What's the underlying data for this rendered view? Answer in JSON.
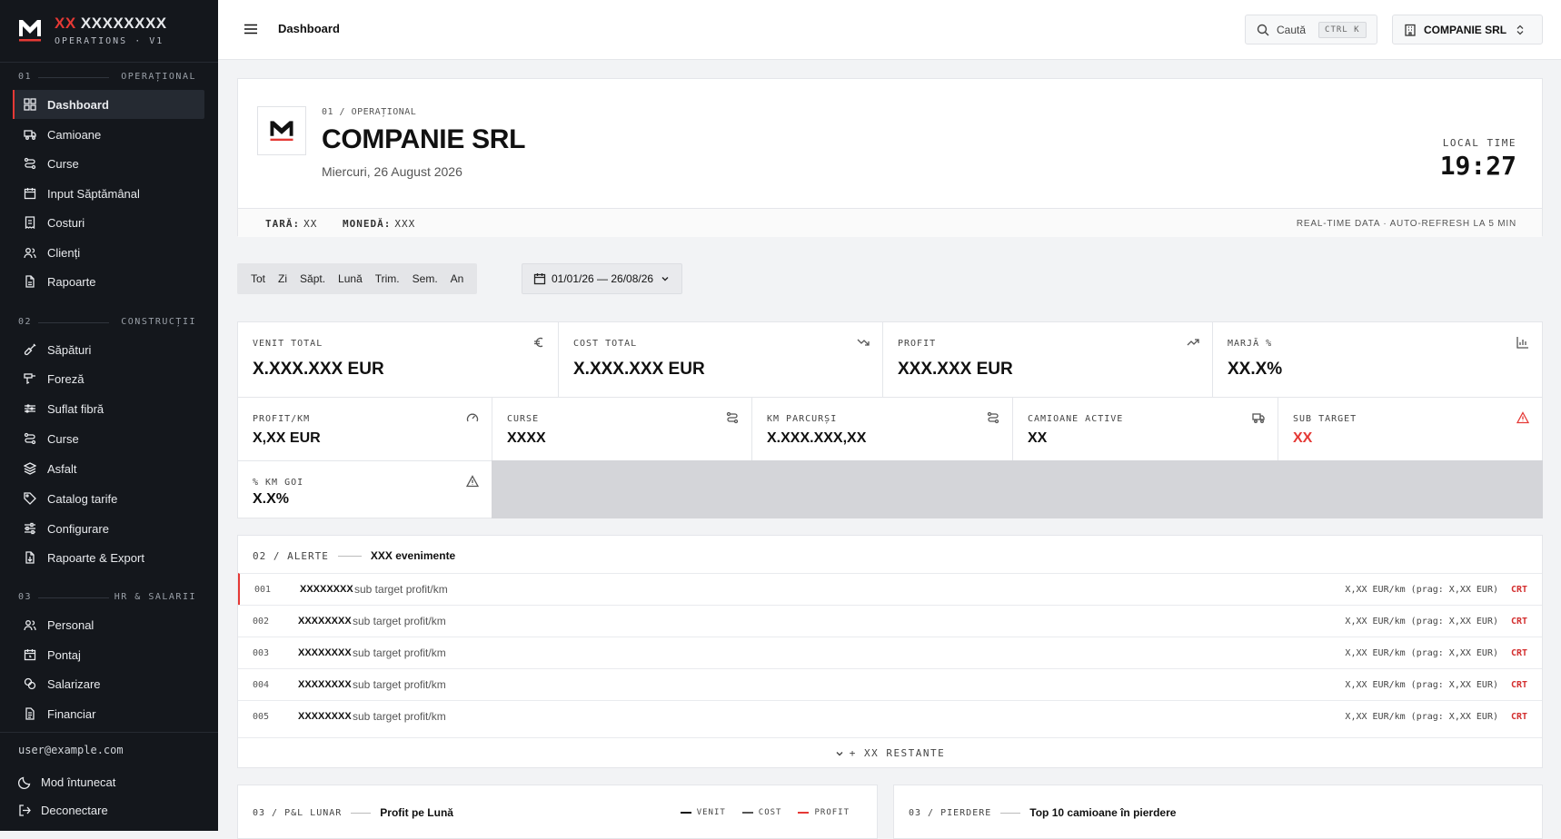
{
  "app": {
    "brand_prefix": "XX",
    "brand_name": "XXXXXXXX",
    "brand_sub": "OPERATIONS · V1"
  },
  "sidebar": {
    "sections": [
      {
        "num": "01",
        "label": "OPERAȚIONAL"
      },
      {
        "num": "02",
        "label": "CONSTRUCȚII"
      },
      {
        "num": "03",
        "label": "HR & SALARII"
      }
    ],
    "operational": [
      "Dashboard",
      "Camioane",
      "Curse",
      "Input Săptămânal",
      "Costuri",
      "Clienți",
      "Rapoarte"
    ],
    "constructii": [
      "Săpături",
      "Foreză",
      "Suflat fibră",
      "Curse",
      "Asfalt",
      "Catalog tarife",
      "Configurare",
      "Rapoarte & Export"
    ],
    "hr": [
      "Personal",
      "Pontaj",
      "Salarizare",
      "Financiar"
    ],
    "user_email": "user@example.com",
    "dark_mode": "Mod întunecat",
    "logout": "Deconectare"
  },
  "topbar": {
    "breadcrumb": "Dashboard",
    "search_label": "Caută",
    "search_kbd": "CTRL K",
    "company": "COMPANIE SRL"
  },
  "header": {
    "eyebrow": "01 / OPERAȚIONAL",
    "title": "COMPANIE SRL",
    "date": "Miercuri, 26 August 2026",
    "local_time_label": "LOCAL TIME",
    "local_time": "19:27",
    "country_label": "TARĂ:",
    "country_value": "XX",
    "currency_label": "MONEDĂ:",
    "currency_value": "XXX",
    "realtime": "REAL-TIME DATA · AUTO-REFRESH LA 5 MIN"
  },
  "period": {
    "options": [
      "Tot",
      "Zi",
      "Săpt.",
      "Lună",
      "Trim.",
      "Sem.",
      "An"
    ],
    "date_range": "01/01/26 — 26/08/26"
  },
  "kpis": {
    "venit": {
      "label": "VENIT TOTAL",
      "value": "X.XXX.XXX EUR"
    },
    "cost": {
      "label": "COST TOTAL",
      "value": "X.XXX.XXX EUR"
    },
    "profit": {
      "label": "PROFIT",
      "value": "XXX.XXX EUR"
    },
    "marja": {
      "label": "MARJĂ %",
      "value": "XX.X%"
    },
    "profit_km": {
      "label": "PROFIT/KM",
      "value": "X,XX EUR"
    },
    "curse": {
      "label": "CURSE",
      "value": "XXXX"
    },
    "km": {
      "label": "KM PARCURȘI",
      "value": "X.XXX.XXX,XX"
    },
    "camioane": {
      "label": "CAMIOANE ACTIVE",
      "value": "XX"
    },
    "sub_target": {
      "label": "SUB TARGET",
      "value": "XX"
    },
    "km_goi": {
      "label": "% KM GOI",
      "value": "X.X%"
    },
    "colors": {
      "alert": "#e53935"
    }
  },
  "alerts": {
    "eyebrow": "02 / ALERTE",
    "count": "XXX evenimente",
    "rows": [
      {
        "id": "001",
        "name": "XXXXXXXX",
        "desc": "sub target profit/km",
        "metric": "X,XX EUR/km (prag: X,XX EUR)",
        "sev": "CRT"
      },
      {
        "id": "002",
        "name": "XXXXXXXX",
        "desc": "sub target profit/km",
        "metric": "X,XX EUR/km (prag: X,XX EUR)",
        "sev": "CRT"
      },
      {
        "id": "003",
        "name": "XXXXXXXX",
        "desc": "sub target profit/km",
        "metric": "X,XX EUR/km (prag: X,XX EUR)",
        "sev": "CRT"
      },
      {
        "id": "004",
        "name": "XXXXXXXX",
        "desc": "sub target profit/km",
        "metric": "X,XX EUR/km (prag: X,XX EUR)",
        "sev": "CRT"
      },
      {
        "id": "005",
        "name": "XXXXXXXX",
        "desc": "sub target profit/km",
        "metric": "X,XX EUR/km (prag: X,XX EUR)",
        "sev": "CRT"
      }
    ],
    "more": "+ XX RESTANTE"
  },
  "pl": {
    "eyebrow": "03 / P&L LUNAR",
    "title": "Profit pe Lună",
    "legend": [
      "VENIT",
      "COST",
      "PROFIT"
    ],
    "legend_colors": [
      "#111111",
      "#555555",
      "#e53935"
    ]
  },
  "loss": {
    "eyebrow": "03 / PIERDERE",
    "title": "Top 10 camioane în pierdere"
  }
}
